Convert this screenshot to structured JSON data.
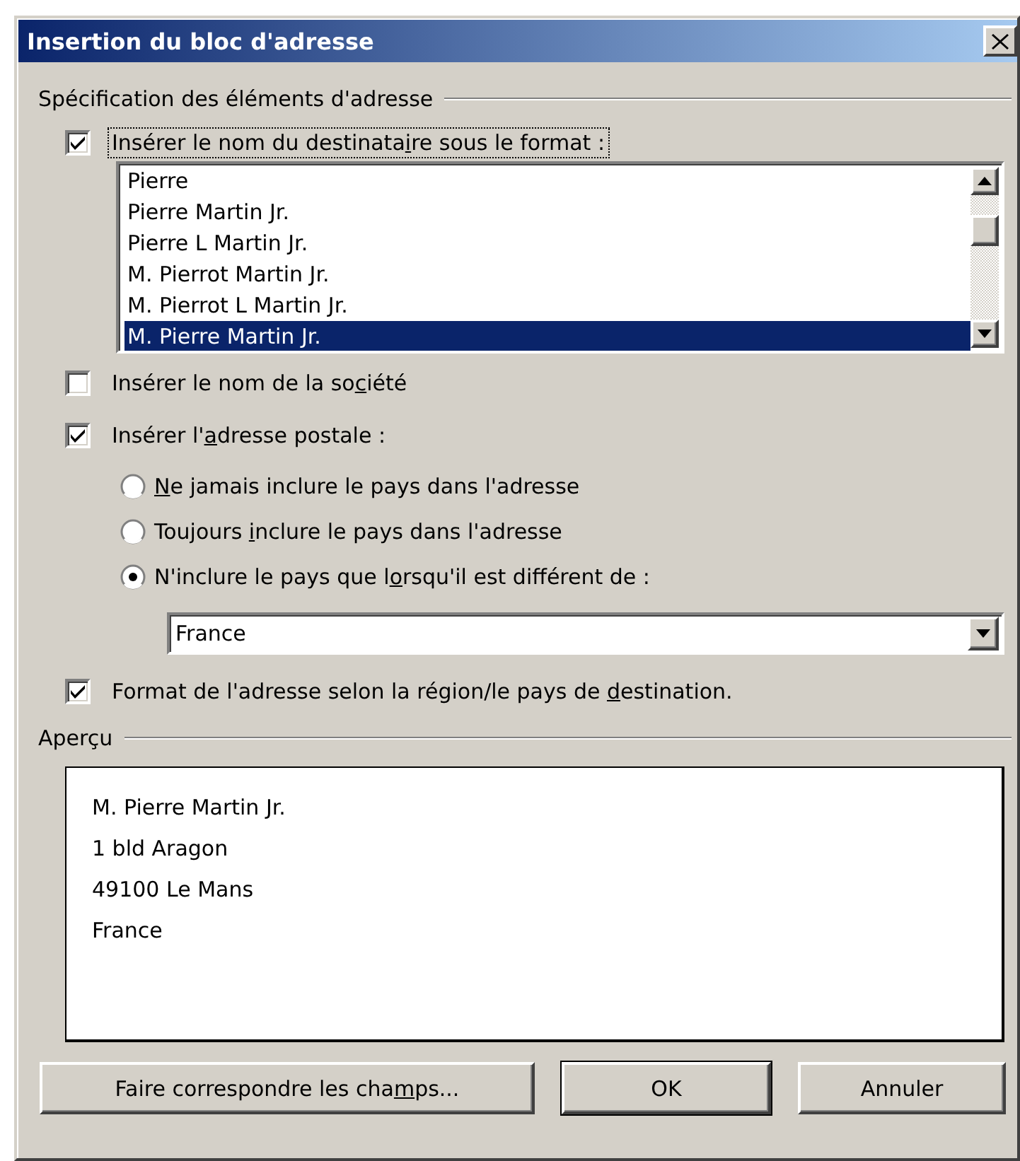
{
  "window": {
    "title": "Insertion du bloc d'adresse"
  },
  "address_elements": {
    "heading": "Spécification des éléments d'adresse",
    "recipient_name": {
      "label": [
        "Insérer le nom du destinata",
        "i",
        "re sous le format :"
      ],
      "checked": true,
      "focused": true,
      "formats": [
        {
          "text": "Pierre",
          "selected": false
        },
        {
          "text": "Pierre Martin Jr.",
          "selected": false
        },
        {
          "text": "Pierre L Martin Jr.",
          "selected": false
        },
        {
          "text": "M. Pierrot Martin Jr.",
          "selected": false
        },
        {
          "text": "M. Pierrot L Martin Jr.",
          "selected": false
        },
        {
          "text": "M. Pierre Martin Jr.",
          "selected": true
        }
      ]
    },
    "company_name": {
      "label": [
        "Insérer le nom de la so",
        "c",
        "iété"
      ],
      "checked": false
    },
    "postal_address": {
      "label": [
        "Insérer l'",
        "a",
        "dresse postale :"
      ],
      "checked": true,
      "country_options": [
        {
          "label": {
            "access_key": "N",
            "after": "e jamais inclure le pays dans l'adresse"
          },
          "selected": false
        },
        {
          "label": [
            "Toujours ",
            "i",
            "nclure le pays dans l'adresse"
          ],
          "selected": false
        },
        {
          "label": [
            "N'inclure le pays que l",
            "o",
            "rsqu'il est différent de :"
          ],
          "selected": true
        }
      ],
      "country": "France"
    },
    "format_by_region": {
      "label": [
        "Format de l'adresse selon la région/le pays de ",
        "d",
        "estination."
      ],
      "checked": true
    }
  },
  "preview": {
    "heading": "Aperçu",
    "lines": [
      "M. Pierre Martin Jr.",
      "1 bld Aragon",
      "49100 Le Mans",
      "France"
    ]
  },
  "buttons": [
    {
      "label": [
        "Faire correspondre les cha",
        "m",
        "ps..."
      ],
      "default": false
    },
    {
      "label": [
        "OK"
      ],
      "default": true
    },
    {
      "label": [
        "Annuler"
      ],
      "default": false
    }
  ]
}
